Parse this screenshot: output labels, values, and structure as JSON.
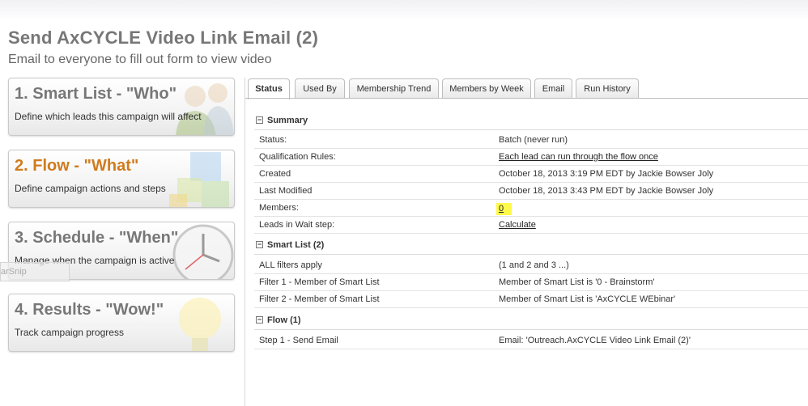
{
  "header": {
    "title": "Send AxCYCLE Video Link Email (2)",
    "subtitle": "Email to everyone to fill out form to view video"
  },
  "cards": [
    {
      "head": "1. Smart List - \"Who\"",
      "desc": "Define which leads this campaign will affect"
    },
    {
      "head": "2. Flow - \"What\"",
      "desc": "Define campaign actions and steps"
    },
    {
      "head": "3. Schedule - \"When\"",
      "desc": "Manage when the campaign is active"
    },
    {
      "head": "4. Results - \"Wow!\"",
      "desc": "Track campaign progress"
    }
  ],
  "snip_fragment": "arSnip",
  "tabs": [
    "Status",
    "Used By",
    "Membership Trend",
    "Members by Week",
    "Email",
    "Run History"
  ],
  "sections": {
    "summary": "Summary",
    "smartlist": "Smart List (2)",
    "flow": "Flow (1)"
  },
  "summary_rows": [
    {
      "k": "Status:",
      "v": "Batch (never run)"
    },
    {
      "k": "Qualification Rules:",
      "v": "Each lead can run through the flow once"
    },
    {
      "k": "Created",
      "v": "October 18, 2013 3:19 PM EDT by Jackie Bowser Joly"
    },
    {
      "k": "Last Modified",
      "v": "October 18, 2013 3:43 PM EDT by Jackie Bowser Joly"
    },
    {
      "k": "Members:",
      "v": "0"
    },
    {
      "k": "Leads in Wait step:",
      "v": "Calculate"
    }
  ],
  "smartlist_rows": [
    {
      "k": "ALL filters apply",
      "v": "(1 and 2 and 3 ...)"
    },
    {
      "k": "Filter 1 - Member of Smart List",
      "v": "Member of Smart List is '0 - Brainstorm'"
    },
    {
      "k": "Filter 2 - Member of Smart List",
      "v": "Member of Smart List is 'AxCYCLE WEbinar'"
    }
  ],
  "flow_rows": [
    {
      "k": "Step 1 - Send Email",
      "v": "Email: 'Outreach.AxCYCLE Video Link Email (2)'"
    }
  ],
  "section_toggle": "−",
  "colors": {
    "active_card_heading": "#d07b1e",
    "highlight": "#fff94a"
  }
}
